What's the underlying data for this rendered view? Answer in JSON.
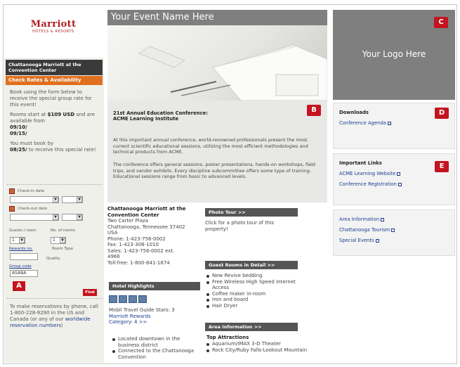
{
  "sidebar": {
    "logo_brand": "Marriott",
    "logo_sub": "HOTELS & RESORTS",
    "hotel_title": "Chattanooga Marriott at the Convention Center",
    "check_rates": "Check Rates & Availability",
    "book_p1": "Book using the form below to receive the special group rate for this event!",
    "book_p2_a": "Rooms start at ",
    "book_price": "$109 USD",
    "book_p2_b": " and are available from",
    "date_from": "09/10/",
    "date_to": "09/15/",
    "book_p3_a": "You must book by",
    "book_deadline": "08/25/",
    "book_p3_b": " to receive this special rate!",
    "checkin_label": "Check-in date",
    "checkout_label": "Check-out date",
    "guests_label": "Guests / room",
    "rooms_label": "No. of rooms",
    "guests_value": "1",
    "rooms_value": "1",
    "rewards_label": "Rewards no.",
    "room_type_label": "Room Type",
    "quality_label": "Quality",
    "group_code_label": "Group code",
    "group_code_value": "ASABA",
    "badge": "A",
    "find_button": "Find",
    "reserve_text": "To make reservations by phone, call 1-800-228-9290 in the US and Canada (or any of our ",
    "reserve_link": "worldwide reservation numbers",
    "reserve_end": ")"
  },
  "main": {
    "event_title": "Your Event Name Here",
    "badge_b": "B",
    "conf_title_1": "21st Annual Education Conference:",
    "conf_title_2": "ACME Learning Institute",
    "conf_p1": "At this important annual conference, world-renowned professionals present the most current scientific educational sessions, utilizing the most efficient methodologies and technical products from ACME.",
    "conf_p2": "The conference offers general sessions, poster presentations, hands-on workshops, field trips, and vendor exhibits. Every discipline subcommittee offers some type of training. Educational sessions range from basic to advanced levels."
  },
  "hotel": {
    "name_1": "Chattanooga Marriott at the",
    "name_2": "Convention Center",
    "address_1": "Two Carter Plaza",
    "address_2": "Chattanooga, Tennessee 37402",
    "country": "USA",
    "phone": "Phone:  1-423-756-0002",
    "fax": "Fax:  1-423-308-1010",
    "sales_1": "Sales:  1-423-756-0002 ext.",
    "sales_2": "4966",
    "tollfree": "Toll-free:  1-800-841-1674",
    "highlights_bar": "Hotel Highlights",
    "mobil_1": "Mobil Travel Guide Stars: 3",
    "mobil_2": "Marriott Rewards",
    "mobil_3": "Category: 4 >>",
    "highlights": [
      "Located downtown in the business district",
      "Connected to the Chattanooga Convention"
    ]
  },
  "col3": {
    "photo_bar": "Photo Tour >>",
    "photo_text": "Click for a photo tour of this property!",
    "guest_bar": "Guest Rooms in Detail >>",
    "guest_items": [
      "New Revive bedding",
      "Free Wireless High Speed Internet Access",
      "Coffee maker in-room",
      "Iron and board",
      "Hair Dryer"
    ],
    "area_bar": "Area Information >>",
    "top_attractions": "Top Attractions",
    "attractions": [
      "Aquarium/IMAX 3-D Theater",
      "Rock City/Ruby Falls-Lookout Mountain"
    ]
  },
  "right": {
    "logo_text": "Your Logo Here",
    "badge_c": "C",
    "downloads_head": "Downloads",
    "download_link": "Conference Agenda",
    "badge_d": "D",
    "links_head": "Important Links",
    "link1": "ACME Learning Website",
    "link2": "Conference Registration",
    "badge_e": "E",
    "area_link": "Area Information",
    "tourism_link": "Chattanooga Tourism",
    "events_link": "Special Events"
  }
}
